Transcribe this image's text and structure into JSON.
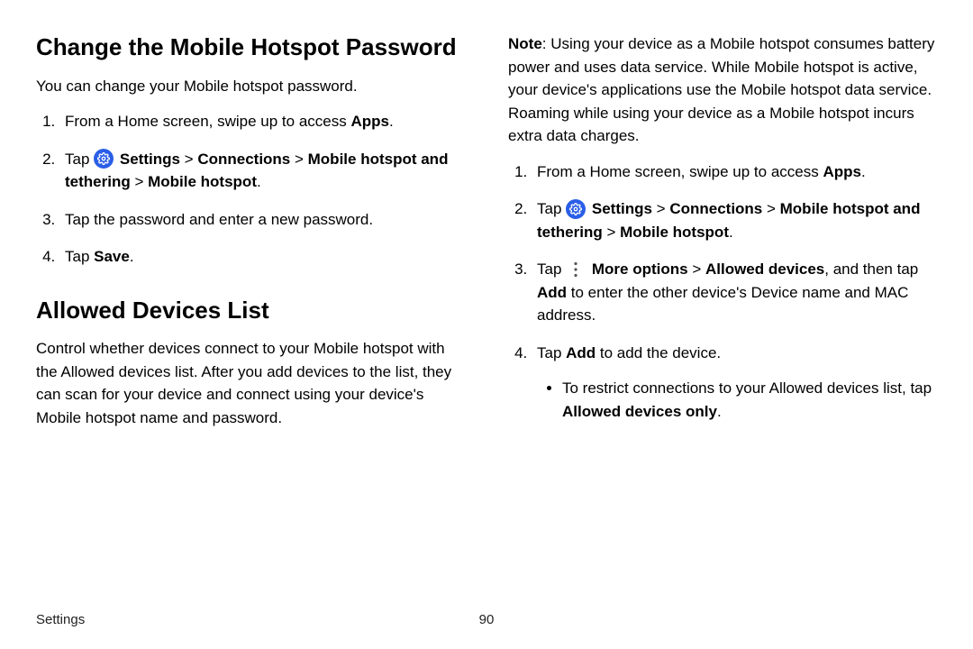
{
  "left": {
    "h1": "Change the Mobile Hotspot Password",
    "intro": "You can change your Mobile hotspot password.",
    "steps": {
      "s1_a": "From a Home screen, swipe up to access ",
      "s1_b": "Apps",
      "s1_c": ".",
      "s2_a": "Tap ",
      "s2_b": "Settings",
      "s2_c": " > ",
      "s2_d": "Connections",
      "s2_e": " > ",
      "s2_f": "Mobile hotspot and tethering",
      "s2_g": " > ",
      "s2_h": "Mobile hotspot",
      "s2_i": ".",
      "s3": "Tap the password and enter a new password.",
      "s4_a": "Tap ",
      "s4_b": "Save",
      "s4_c": "."
    },
    "h2": "Allowed Devices List",
    "intro2": "Control whether devices connect to your Mobile hotspot with the Allowed devices list. After you add devices to the list, they can scan for your device and connect using your device's Mobile hotspot name and password."
  },
  "right": {
    "note_label": "Note",
    "note_body": ": Using your device as a Mobile hotspot consumes battery power and uses data service. While Mobile hotspot is active, your device's applications use the Mobile hotspot data service. Roaming while using your device as a Mobile hotspot incurs extra data charges.",
    "steps": {
      "s1_a": "From a Home screen, swipe up to access ",
      "s1_b": "Apps",
      "s1_c": ".",
      "s2_a": "Tap ",
      "s2_b": "Settings",
      "s2_c": " > ",
      "s2_d": "Connections",
      "s2_e": " > ",
      "s2_f": "Mobile hotspot and tethering",
      "s2_g": " > ",
      "s2_h": "Mobile hotspot",
      "s2_i": ".",
      "s3_a": "Tap ",
      "s3_b": "More options",
      "s3_c": " > ",
      "s3_d": "Allowed devices",
      "s3_e": ", and then tap ",
      "s3_f": "Add",
      "s3_g": " to enter the other device's Device name and MAC address.",
      "s4_a": "Tap ",
      "s4_b": "Add",
      "s4_c": " to add the device.",
      "bullet_a": "To restrict connections to your Allowed devices list, tap ",
      "bullet_b": "Allowed devices only",
      "bullet_c": "."
    }
  },
  "footer": {
    "section": "Settings",
    "page": "90"
  }
}
